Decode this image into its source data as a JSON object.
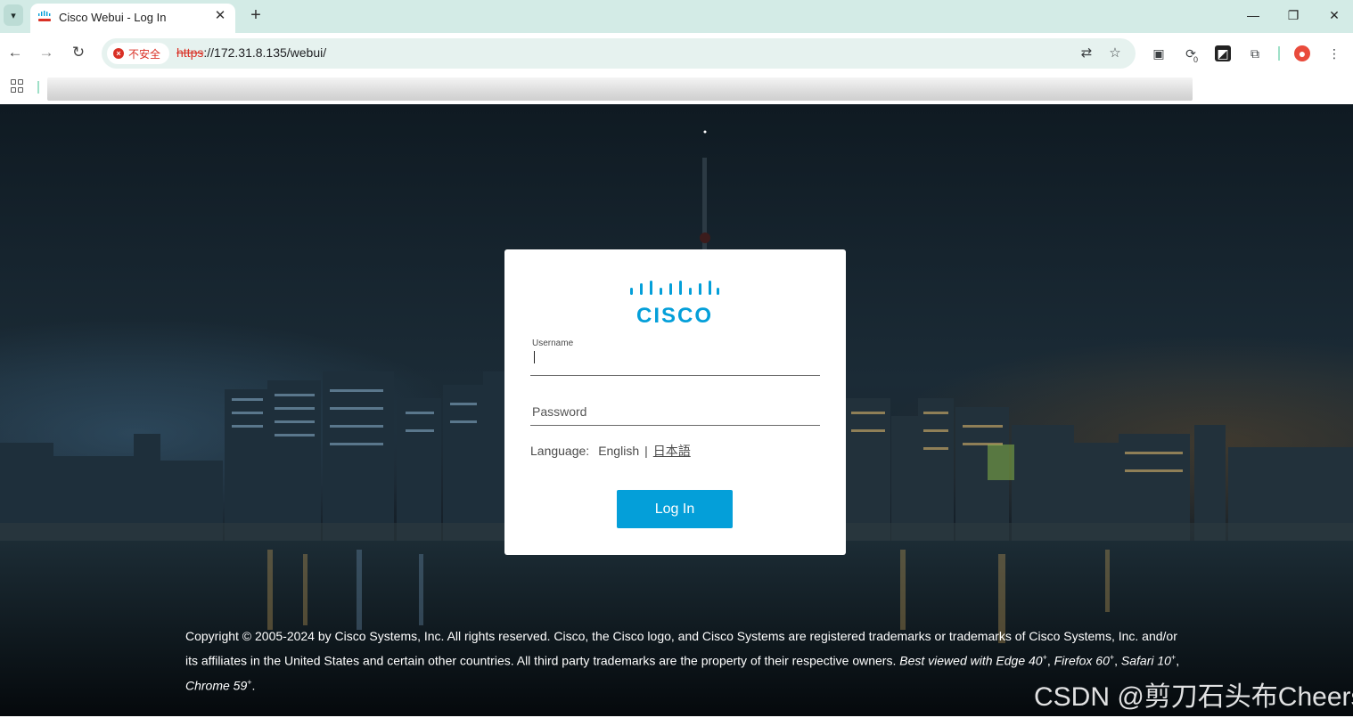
{
  "browser": {
    "tab": {
      "title": "Cisco Webui - Log In",
      "favicon": "cisco-favicon",
      "close": "✕"
    },
    "new_tab": "+",
    "window": {
      "minimize": "—",
      "restore": "❐",
      "close": "✕"
    },
    "security_chip": "不安全",
    "url_scheme": "https",
    "url_rest": "://172.31.8.135/webui/",
    "extension_badge": "0"
  },
  "login": {
    "username_label": "Username",
    "password_placeholder": "Password",
    "language_label": "Language:",
    "language_english": "English",
    "language_separator": "|",
    "language_japanese": "日本語",
    "login_button": "Log In"
  },
  "footer": {
    "copyright": "Copyright © 2005-2024 by Cisco Systems, Inc. All rights reserved. Cisco, the Cisco logo, and Cisco Systems are registered trademarks or trademarks of Cisco Systems, Inc. and/or its affiliates in the United States and certain other countries. All third party trademarks are the property of their respective owners.",
    "best_viewed": "Best viewed with Edge 40",
    "firefox": "Firefox 60",
    "safari": "Safari 10",
    "chrome": "Chrome 59",
    "plus": "+"
  },
  "watermark": "CSDN @剪刀石头布Cheers",
  "colors": {
    "accent": "#049fd9",
    "tab_strip": "#d3ebe6",
    "insecure": "#d93025"
  }
}
